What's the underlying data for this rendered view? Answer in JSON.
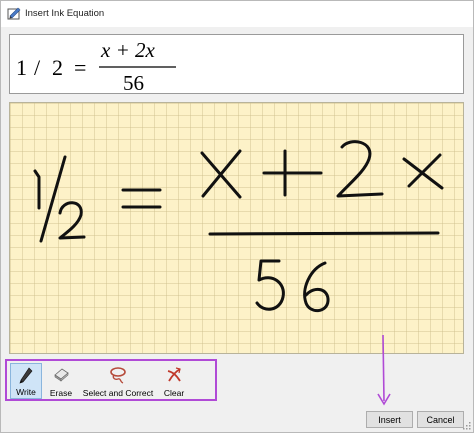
{
  "window": {
    "title": "Insert Ink Equation",
    "icon": "pen-equation-icon"
  },
  "preview": {
    "lhs_num": "1",
    "lhs_slash": "/",
    "lhs_den": "2",
    "equals": "=",
    "numerator": "x + 2x",
    "denominator": "56"
  },
  "ink": {
    "description_icon": "handwritten-ink",
    "paper_color": "#fdf2c8"
  },
  "toolbar": {
    "tools": [
      {
        "label": "Write",
        "icon": "pen-icon",
        "active": true
      },
      {
        "label": "Erase",
        "icon": "eraser-icon",
        "active": false
      },
      {
        "label": "Select and Correct",
        "icon": "lasso-icon",
        "active": false
      },
      {
        "label": "Clear",
        "icon": "clear-icon",
        "active": false
      }
    ],
    "highlight_color": "#b04ad6"
  },
  "buttons": {
    "insert": "Insert",
    "cancel": "Cancel"
  },
  "annotation": {
    "arrow_color": "#b04ad6"
  }
}
